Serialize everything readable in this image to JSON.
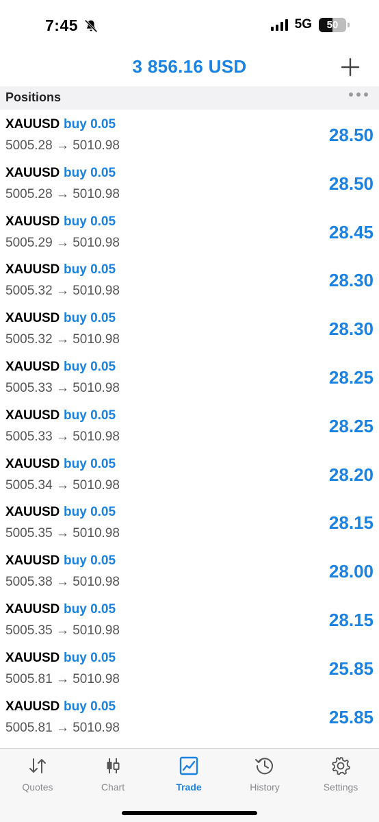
{
  "status_bar": {
    "time": "7:45",
    "network": "5G",
    "battery_level": "50",
    "battery_fraction": 0.5,
    "icons": [
      "bell-slash-icon",
      "signal-icon",
      "battery-icon"
    ]
  },
  "header": {
    "balance": "3 856.16 USD",
    "add_icon": "plus-icon"
  },
  "section": {
    "title": "Positions",
    "more_icon": "more-icon"
  },
  "positions": [
    {
      "symbol": "XAUUSD",
      "side": "buy 0.05",
      "prices": "5005.28 → 5010.98",
      "profit": "28.50"
    },
    {
      "symbol": "XAUUSD",
      "side": "buy 0.05",
      "prices": "5005.28 → 5010.98",
      "profit": "28.50"
    },
    {
      "symbol": "XAUUSD",
      "side": "buy 0.05",
      "prices": "5005.29 → 5010.98",
      "profit": "28.45"
    },
    {
      "symbol": "XAUUSD",
      "side": "buy 0.05",
      "prices": "5005.32 → 5010.98",
      "profit": "28.30"
    },
    {
      "symbol": "XAUUSD",
      "side": "buy 0.05",
      "prices": "5005.32 → 5010.98",
      "profit": "28.30"
    },
    {
      "symbol": "XAUUSD",
      "side": "buy 0.05",
      "prices": "5005.33 → 5010.98",
      "profit": "28.25"
    },
    {
      "symbol": "XAUUSD",
      "side": "buy 0.05",
      "prices": "5005.33 → 5010.98",
      "profit": "28.25"
    },
    {
      "symbol": "XAUUSD",
      "side": "buy 0.05",
      "prices": "5005.34 → 5010.98",
      "profit": "28.20"
    },
    {
      "symbol": "XAUUSD",
      "side": "buy 0.05",
      "prices": "5005.35 → 5010.98",
      "profit": "28.15"
    },
    {
      "symbol": "XAUUSD",
      "side": "buy 0.05",
      "prices": "5005.38 → 5010.98",
      "profit": "28.00"
    },
    {
      "symbol": "XAUUSD",
      "side": "buy 0.05",
      "prices": "5005.35 → 5010.98",
      "profit": "28.15"
    },
    {
      "symbol": "XAUUSD",
      "side": "buy 0.05",
      "prices": "5005.81 → 5010.98",
      "profit": "25.85"
    },
    {
      "symbol": "XAUUSD",
      "side": "buy 0.05",
      "prices": "5005.81 → 5010.98",
      "profit": "25.85"
    }
  ],
  "tabs": [
    {
      "label": "Quotes",
      "icon": "quotes-icon",
      "active": false
    },
    {
      "label": "Chart",
      "icon": "chart-icon",
      "active": false
    },
    {
      "label": "Trade",
      "icon": "trade-icon",
      "active": true
    },
    {
      "label": "History",
      "icon": "history-icon",
      "active": false
    },
    {
      "label": "Settings",
      "icon": "settings-icon",
      "active": false
    }
  ],
  "colors": {
    "accent": "#1a82e2",
    "inactive_tab": "#8a8a8f",
    "section_bg": "#f2f2f4"
  }
}
